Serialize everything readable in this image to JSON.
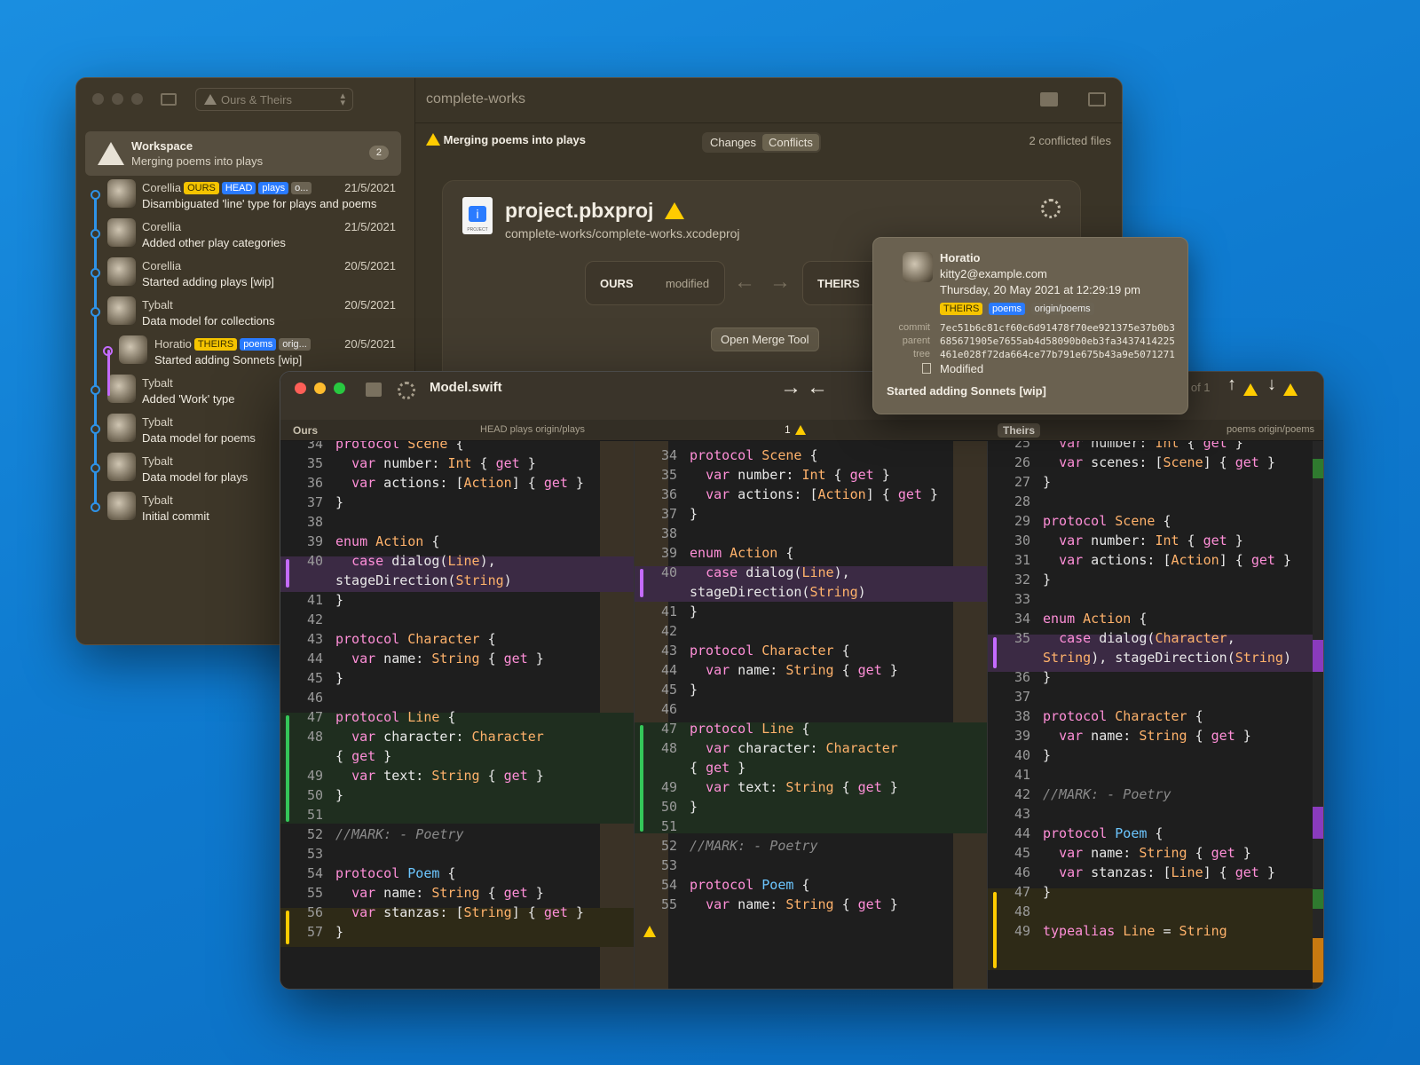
{
  "back_window": {
    "branch_selector": "Ours & Theirs",
    "title": "complete-works",
    "workspace": {
      "title": "Workspace",
      "subtitle": "Merging poems into plays",
      "count": "2"
    },
    "commits": [
      {
        "author": "Corellia",
        "message": "Disambiguated 'line' type for plays and poems",
        "date": "21/5/2021",
        "tags": [
          "OURS",
          "HEAD",
          "plays",
          "o..."
        ]
      },
      {
        "author": "Corellia",
        "message": "Added other play categories",
        "date": "21/5/2021",
        "tags": []
      },
      {
        "author": "Corellia",
        "message": "Started adding plays [wip]",
        "date": "20/5/2021",
        "tags": []
      },
      {
        "author": "Tybalt",
        "message": "Data model for collections",
        "date": "20/5/2021",
        "tags": []
      },
      {
        "author": "Horatio",
        "message": "Started adding Sonnets [wip]",
        "date": "20/5/2021",
        "tags": [
          "THEIRS",
          "poems",
          "orig..."
        ]
      },
      {
        "author": "Tybalt",
        "message": "Added 'Work' type",
        "date": "",
        "tags": []
      },
      {
        "author": "Tybalt",
        "message": "Data model for poems",
        "date": "",
        "tags": []
      },
      {
        "author": "Tybalt",
        "message": "Data model for plays",
        "date": "",
        "tags": []
      },
      {
        "author": "Tybalt",
        "message": "Initial commit",
        "date": "",
        "tags": []
      }
    ],
    "merge_banner": "Merging poems into plays",
    "tabs": [
      "Changes",
      "Conflicts"
    ],
    "conflicted": "2 conflicted files",
    "file": {
      "name": "project.pbxproj",
      "path": "complete-works/complete-works.xcodeproj",
      "icon_label": "PROJECT"
    },
    "ours_label": "OURS",
    "ours_state": "modified",
    "theirs_label": "THEIRS",
    "merge_tool_button": "Open Merge Tool"
  },
  "tooltip": {
    "author": "Horatio",
    "email": "kitty2@example.com",
    "date": "Thursday, 20 May 2021 at 12:29:19 pm",
    "tags": [
      "THEIRS",
      "poems",
      "origin/poems"
    ],
    "commit_label": "commit",
    "commit": "7ec51b6c81cf60c6d91478f70ee921375e37b0b3",
    "parent_label": "parent",
    "parent": "685671905e7655ab4d58090b0eb3fa3437414225",
    "tree_label": "tree",
    "tree": "461e028f72da664ce77b791e675b43a9e5071271",
    "status": "Modified",
    "message": "Started adding Sonnets [wip]"
  },
  "front_window": {
    "filename": "Model.swift",
    "conflict_nav": "1 of 1",
    "ours_header": "Ours",
    "ours_refs": "HEAD plays origin/plays",
    "middle_marker": "1",
    "theirs_header": "Theirs",
    "theirs_refs": "poems origin/poems"
  },
  "code": {
    "left": [
      [
        "34",
        "protocol Scene {"
      ],
      [
        "35",
        "  var number: Int { get }"
      ],
      [
        "36",
        "  var actions: [Action] { get }"
      ],
      [
        "37",
        "}"
      ],
      [
        "38",
        ""
      ],
      [
        "39",
        "enum Action {"
      ],
      [
        "40",
        "  case dialog(Line),"
      ],
      [
        "",
        "stageDirection(String)"
      ],
      [
        "41",
        "}"
      ],
      [
        "42",
        ""
      ],
      [
        "43",
        "protocol Character {"
      ],
      [
        "44",
        "  var name: String { get }"
      ],
      [
        "45",
        "}"
      ],
      [
        "46",
        ""
      ],
      [
        "47",
        "protocol Line {"
      ],
      [
        "48",
        "  var character: Character"
      ],
      [
        "",
        "{ get }"
      ],
      [
        "49",
        "  var text: String { get }"
      ],
      [
        "50",
        "}"
      ],
      [
        "51",
        ""
      ],
      [
        "52",
        "//MARK: - Poetry"
      ],
      [
        "53",
        ""
      ],
      [
        "54",
        "protocol Poem {"
      ],
      [
        "55",
        "  var name: String { get }"
      ],
      [
        "56",
        "  var stanzas: [String] { get }"
      ],
      [
        "57",
        "}"
      ]
    ],
    "middle": [
      [
        "34",
        "protocol Scene {"
      ],
      [
        "35",
        "  var number: Int { get }"
      ],
      [
        "36",
        "  var actions: [Action] { get }"
      ],
      [
        "37",
        "}"
      ],
      [
        "38",
        ""
      ],
      [
        "39",
        "enum Action {"
      ],
      [
        "40",
        "  case dialog(Line),"
      ],
      [
        "",
        "stageDirection(String)"
      ],
      [
        "41",
        "}"
      ],
      [
        "42",
        ""
      ],
      [
        "43",
        "protocol Character {"
      ],
      [
        "44",
        "  var name: String { get }"
      ],
      [
        "45",
        "}"
      ],
      [
        "46",
        ""
      ],
      [
        "47",
        "protocol Line {"
      ],
      [
        "48",
        "  var character: Character"
      ],
      [
        "",
        "{ get }"
      ],
      [
        "49",
        "  var text: String { get }"
      ],
      [
        "50",
        "}"
      ],
      [
        "51",
        ""
      ],
      [
        "52",
        "//MARK: - Poetry"
      ],
      [
        "53",
        ""
      ],
      [
        "54",
        "protocol Poem {"
      ],
      [
        "55",
        "  var name: String { get }"
      ]
    ],
    "right": [
      [
        "25",
        "  var number: Int { get }"
      ],
      [
        "26",
        "  var scenes: [Scene] { get }"
      ],
      [
        "27",
        "}"
      ],
      [
        "28",
        ""
      ],
      [
        "29",
        "protocol Scene {"
      ],
      [
        "30",
        "  var number: Int { get }"
      ],
      [
        "31",
        "  var actions: [Action] { get }"
      ],
      [
        "32",
        "}"
      ],
      [
        "33",
        ""
      ],
      [
        "34",
        "enum Action {"
      ],
      [
        "35",
        "  case dialog(Character,"
      ],
      [
        "",
        "String), stageDirection(String)"
      ],
      [
        "36",
        "}"
      ],
      [
        "37",
        ""
      ],
      [
        "38",
        "protocol Character {"
      ],
      [
        "39",
        "  var name: String { get }"
      ],
      [
        "40",
        "}"
      ],
      [
        "41",
        ""
      ],
      [
        "42",
        "//MARK: - Poetry"
      ],
      [
        "43",
        ""
      ],
      [
        "44",
        "protocol Poem {"
      ],
      [
        "45",
        "  var name: String { get }"
      ],
      [
        "46",
        "  var stanzas: [Line] { get }"
      ],
      [
        "47",
        "}"
      ],
      [
        "48",
        ""
      ],
      [
        "49",
        "typealias Line = String"
      ]
    ]
  },
  "colors": {
    "ours": "#f5c400",
    "head": "#2a7bff",
    "graph": "#2e93e8",
    "theirs_graph": "#c46bff",
    "desktop": "#1083d6"
  }
}
